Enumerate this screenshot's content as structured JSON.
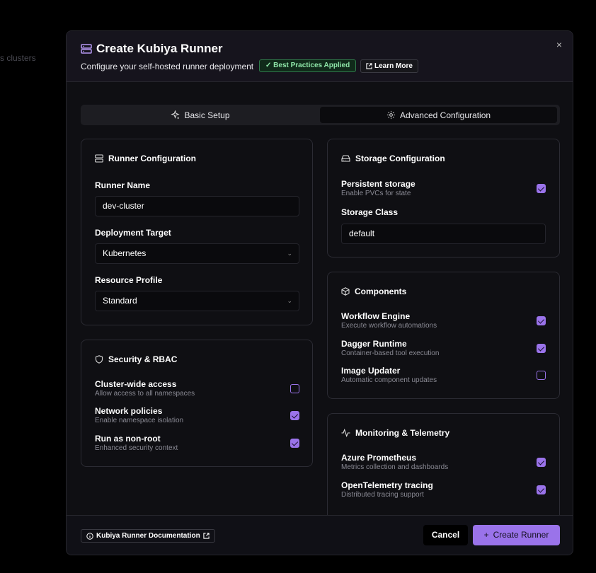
{
  "background": {
    "text": "s clusters"
  },
  "modal": {
    "title": "Create Kubiya Runner",
    "subtitle": "Configure your self-hosted runner deployment",
    "badge": "Best Practices Applied",
    "learn_more": "Learn More",
    "close_label": "×"
  },
  "tabs": [
    {
      "label": "Basic Setup",
      "icon": "sparkles-icon",
      "active": false
    },
    {
      "label": "Advanced Configuration",
      "icon": "gear-icon",
      "active": true
    }
  ],
  "runner_config": {
    "title": "Runner Configuration",
    "name_label": "Runner Name",
    "name_value": "dev-cluster",
    "target_label": "Deployment Target",
    "target_value": "Kubernetes",
    "profile_label": "Resource Profile",
    "profile_value": "Standard"
  },
  "security": {
    "title": "Security & RBAC",
    "options": [
      {
        "title": "Cluster-wide access",
        "desc": "Allow access to all namespaces",
        "checked": false
      },
      {
        "title": "Network policies",
        "desc": "Enable namespace isolation",
        "checked": true
      },
      {
        "title": "Run as non-root",
        "desc": "Enhanced security context",
        "checked": true
      }
    ]
  },
  "storage": {
    "title": "Storage Configuration",
    "persistent_title": "Persistent storage",
    "persistent_desc": "Enable PVCs for state",
    "persistent_checked": true,
    "class_label": "Storage Class",
    "class_value": "default"
  },
  "components": {
    "title": "Components",
    "options": [
      {
        "title": "Workflow Engine",
        "desc": "Execute workflow automations",
        "checked": true
      },
      {
        "title": "Dagger Runtime",
        "desc": "Container-based tool execution",
        "checked": true
      },
      {
        "title": "Image Updater",
        "desc": "Automatic component updates",
        "checked": false
      }
    ]
  },
  "monitoring": {
    "title": "Monitoring & Telemetry",
    "options": [
      {
        "title": "Azure Prometheus",
        "desc": "Metrics collection and dashboards",
        "checked": true
      },
      {
        "title": "OpenTelemetry tracing",
        "desc": "Distributed tracing support",
        "checked": true
      }
    ]
  },
  "footer": {
    "docs_label": "Kubiya Runner Documentation",
    "cancel_label": "Cancel",
    "create_label": "Create Runner"
  },
  "colors": {
    "accent": "#9a73ea",
    "badge_green": "#8ee6a8",
    "panel_bg": "#0f0f13"
  }
}
